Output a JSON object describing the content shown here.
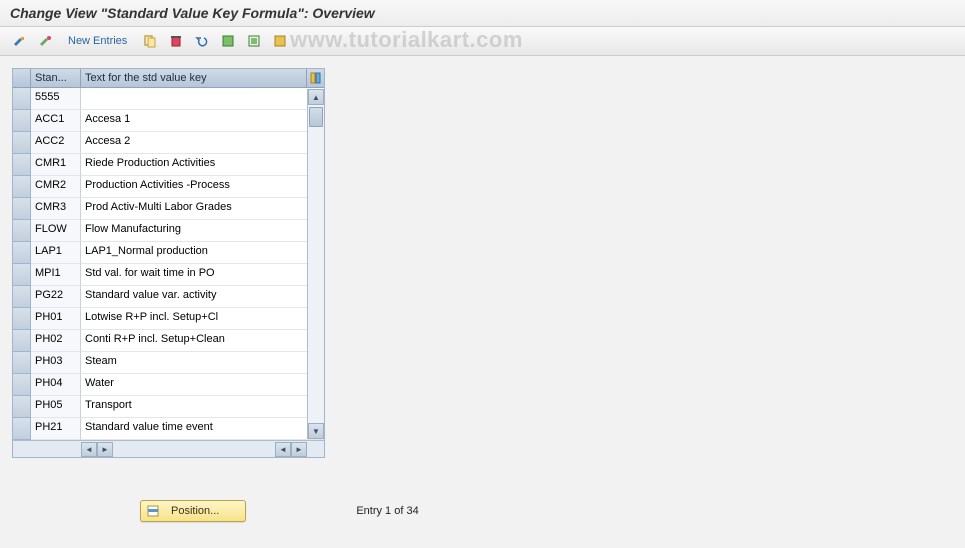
{
  "title": "Change View \"Standard Value Key Formula\": Overview",
  "watermark": "www.tutorialkart.com",
  "toolbar": {
    "new_entries_label": "New Entries"
  },
  "table": {
    "col_key_header": "Stan...",
    "col_text_header": "Text for the std value key",
    "rows": [
      {
        "key": "5555",
        "text": ""
      },
      {
        "key": "ACC1",
        "text": "Accesa 1"
      },
      {
        "key": "ACC2",
        "text": "Accesa 2"
      },
      {
        "key": "CMR1",
        "text": "Riede Production Activities"
      },
      {
        "key": "CMR2",
        "text": "Production Activities -Process"
      },
      {
        "key": "CMR3",
        "text": "Prod Activ-Multi Labor Grades"
      },
      {
        "key": "FLOW",
        "text": "Flow Manufacturing"
      },
      {
        "key": "LAP1",
        "text": "LAP1_Normal production"
      },
      {
        "key": "MPI1",
        "text": "Std val. for wait time in PO"
      },
      {
        "key": "PG22",
        "text": "Standard value var. activity"
      },
      {
        "key": "PH01",
        "text": "Lotwise R+P incl. Setup+Cl"
      },
      {
        "key": "PH02",
        "text": "Conti R+P incl. Setup+Clean"
      },
      {
        "key": "PH03",
        "text": "Steam"
      },
      {
        "key": "PH04",
        "text": "Water"
      },
      {
        "key": "PH05",
        "text": "Transport"
      },
      {
        "key": "PH21",
        "text": "Standard value time event"
      }
    ]
  },
  "footer": {
    "position_label": "Position...",
    "entry_text": "Entry 1 of 34"
  }
}
